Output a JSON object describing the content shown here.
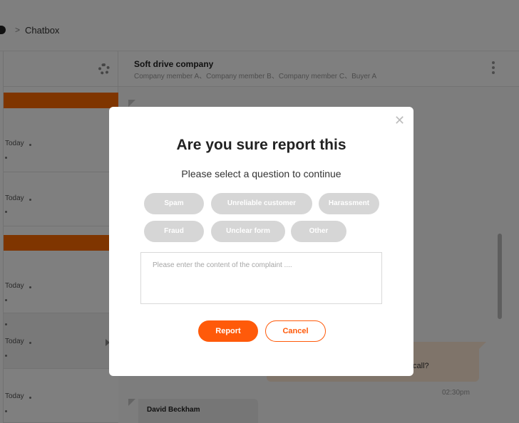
{
  "breadcrumb": {
    "separator": ">",
    "current": "Chatbox"
  },
  "conversations": [
    {
      "time": "Today",
      "dot": "•"
    },
    {
      "time": "Today",
      "dot": "•"
    },
    {
      "time": "Today",
      "dot": "•"
    },
    {
      "time": "Today",
      "dot": "•"
    },
    {
      "time": "Today",
      "dot": "•"
    }
  ],
  "chat": {
    "title": "Soft drive company",
    "members": "Company member A、Company member B、Company member C、Buyer A",
    "outgoing_message": "you free to call?",
    "outgoing_time": "02:30pm",
    "incoming_sender": "David Beckham"
  },
  "modal": {
    "close_icon": "✕",
    "title": "Are you sure report this",
    "subtitle": "Please select a question to continue",
    "reasons": [
      "Spam",
      "Unreliable customer",
      "Harassment",
      "Fraud",
      "Unclear form",
      "Other"
    ],
    "complaint_placeholder": "Please enter the content of the complaint ....",
    "report_label": "Report",
    "cancel_label": "Cancel"
  },
  "colors": {
    "accent": "#ff5a0a",
    "sidebar_accent": "#ff6a00",
    "chip_bg": "#d6d6d6",
    "overlay": "rgba(0,0,0,0.5)"
  }
}
